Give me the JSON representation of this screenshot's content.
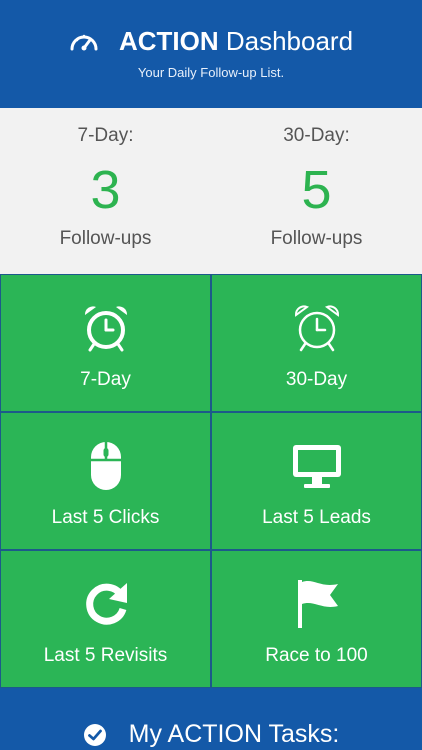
{
  "header": {
    "title_bold": "ACTION",
    "title_rest": "Dashboard",
    "subtitle": "Your Daily Follow-up List."
  },
  "stats": [
    {
      "period": "7-Day:",
      "count": "3",
      "unit": "Follow-ups"
    },
    {
      "period": "30-Day:",
      "count": "5",
      "unit": "Follow-ups"
    }
  ],
  "tiles": [
    {
      "label": "7-Day",
      "icon": "alarm-clock-icon"
    },
    {
      "label": "30-Day",
      "icon": "alarm-clock-outline-icon"
    },
    {
      "label": "Last 5 Clicks",
      "icon": "mouse-icon"
    },
    {
      "label": "Last 5 Leads",
      "icon": "monitor-icon"
    },
    {
      "label": "Last 5 Revisits",
      "icon": "refresh-icon"
    },
    {
      "label": "Race to 100",
      "icon": "flag-icon"
    }
  ],
  "footer": {
    "title": "My ACTION Tasks:",
    "icon": "check-circle-icon"
  },
  "colors": {
    "header_blue": "#1459a8",
    "tile_green": "#2bb556",
    "count_green": "#2db350"
  }
}
